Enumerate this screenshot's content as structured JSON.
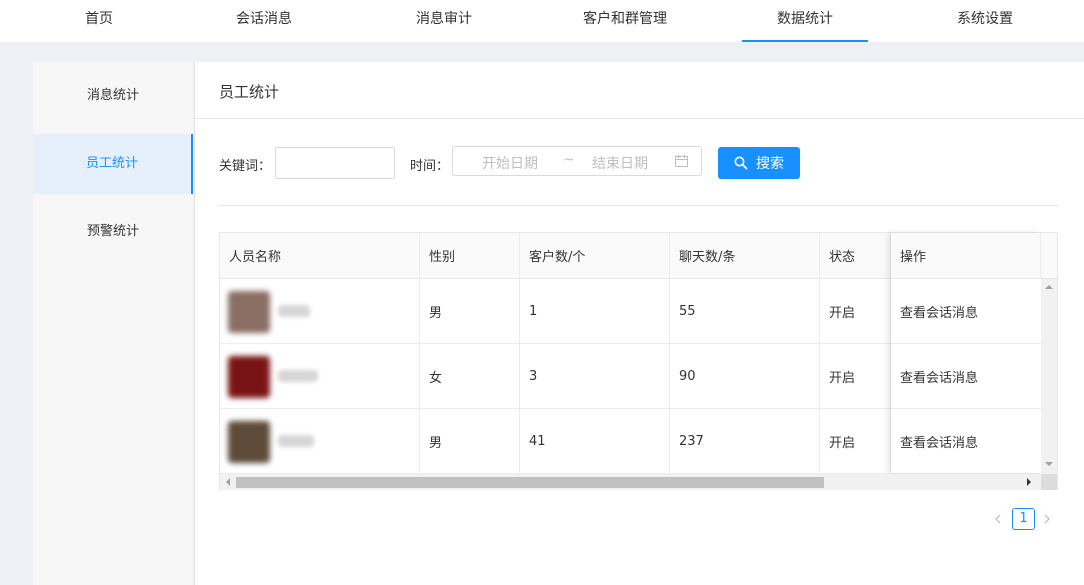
{
  "topnav": {
    "items": [
      {
        "label": "首页"
      },
      {
        "label": "会话消息"
      },
      {
        "label": "消息审计"
      },
      {
        "label": "客户和群管理"
      },
      {
        "label": "数据统计"
      },
      {
        "label": "系统设置"
      }
    ],
    "active_index": 4
  },
  "sidemenu": {
    "items": [
      {
        "label": "消息统计"
      },
      {
        "label": "员工统计"
      },
      {
        "label": "预警统计"
      }
    ],
    "active_index": 1
  },
  "page": {
    "title": "员工统计"
  },
  "filters": {
    "keyword_label": "关键词：",
    "keyword_value": "",
    "time_label": "时间：",
    "start_placeholder": "开始日期",
    "separator": "~",
    "end_placeholder": "结束日期",
    "search_label": "搜索"
  },
  "table": {
    "columns": [
      "人员名称",
      "性别",
      "客户数/个",
      "聊天数/条",
      "状态",
      "操作"
    ],
    "rows": [
      {
        "gender": "男",
        "customers": "1",
        "chats": "55",
        "status": "开启",
        "action": "查看会话消息",
        "avatar_color": "#8a6e64"
      },
      {
        "gender": "女",
        "customers": "3",
        "chats": "90",
        "status": "开启",
        "action": "查看会话消息",
        "avatar_color": "#7a1414"
      },
      {
        "gender": "男",
        "customers": "41",
        "chats": "237",
        "status": "开启",
        "action": "查看会话消息",
        "avatar_color": "#5e4a38"
      }
    ]
  },
  "pagination": {
    "current": "1"
  },
  "colors": {
    "accent": "#1890ff",
    "text": "#333333",
    "active_bg": "#e6f0fd"
  }
}
